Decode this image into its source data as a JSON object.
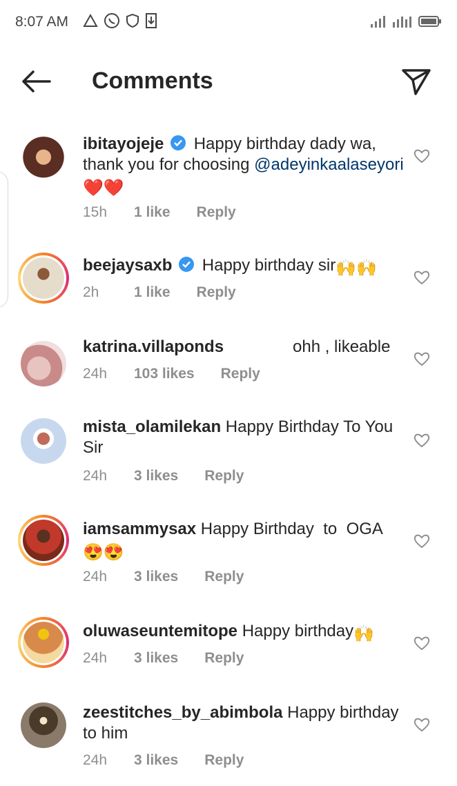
{
  "status_bar": {
    "time": "8:07 AM",
    "icons": [
      "delta-icon",
      "whatsapp-icon",
      "shield-icon",
      "download-icon"
    ],
    "right_icons": [
      "signal-icon",
      "signal-icon-2",
      "battery-icon"
    ]
  },
  "header": {
    "title": "Comments",
    "back_icon": "back-arrow-icon",
    "share_icon": "send-icon"
  },
  "comments": [
    {
      "username": "ibitayojeje",
      "verified": true,
      "text": "Happy birthday dady wa, thank you for choosing",
      "mention": "@adeyinkaalaseyori",
      "emoji": "❤️❤️",
      "time": "15h",
      "likes": "1 like",
      "reply": "Reply",
      "avatar_color": "#7a4a3a",
      "ring": false
    },
    {
      "username": "beejaysaxb",
      "verified": true,
      "text": "Happy birthday sir",
      "emoji": "🙌🙌",
      "time": "2h",
      "likes": "1 like",
      "reply": "Reply",
      "avatar_color": "#c9b99a",
      "ring": true
    },
    {
      "username": "katrina.villaponds",
      "verified": false,
      "text": "ohh , likeable",
      "time": "24h",
      "likes": "103 likes",
      "reply": "Reply",
      "avatar_color": "#d9a8a8",
      "ring": false
    },
    {
      "username": "mista_olamilekan",
      "verified": false,
      "text": "Happy Birthday To You Sir",
      "time": "24h",
      "likes": "3 likes",
      "reply": "Reply",
      "avatar_color": "#b7c9e0",
      "ring": false
    },
    {
      "username": "iamsammysax",
      "verified": false,
      "text": "Happy Birthday  to  OGA",
      "emoji": "😍😍",
      "time": "24h",
      "likes": "3 likes",
      "reply": "Reply",
      "avatar_color": "#8a3a2a",
      "ring": true
    },
    {
      "username": "oluwaseuntemitope",
      "verified": false,
      "text": "Happy birthday",
      "emoji": "🙌",
      "time": "24h",
      "likes": "3 likes",
      "reply": "Reply",
      "avatar_color": "#c98a4a",
      "ring": true
    },
    {
      "username": "zeestitches_by_abimbola",
      "verified": false,
      "text": "Happy birthday to him",
      "time": "24h",
      "likes": "3 likes",
      "reply": "Reply",
      "avatar_color": "#6a5a4a",
      "ring": false
    }
  ]
}
